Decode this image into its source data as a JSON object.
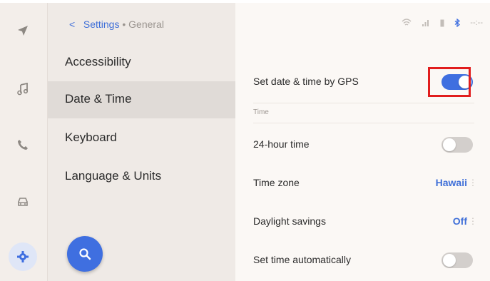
{
  "breadcrumb": {
    "back": "<",
    "parent": "Settings",
    "separator": "•",
    "current": "General"
  },
  "status": {
    "clock": "--:--"
  },
  "rail": [
    "navigation-icon",
    "music-icon",
    "phone-icon",
    "car-icon",
    "gear-icon"
  ],
  "menu": {
    "items": [
      {
        "label": "Accessibility",
        "active": false
      },
      {
        "label": "Date & Time",
        "active": true
      },
      {
        "label": "Keyboard",
        "active": false
      },
      {
        "label": "Language & Units",
        "active": false
      }
    ]
  },
  "detail": {
    "gps": {
      "label": "Set date & time by GPS",
      "enabled": true
    },
    "section": "Time",
    "hour24": {
      "label": "24-hour time",
      "enabled": false
    },
    "timezone": {
      "label": "Time zone",
      "value": "Hawaii"
    },
    "daylight": {
      "label": "Daylight savings",
      "value": "Off"
    },
    "auto": {
      "label": "Set time automatically",
      "enabled": false
    }
  },
  "colors": {
    "accent": "#3f6fe0",
    "highlight": "#e11d1d"
  }
}
